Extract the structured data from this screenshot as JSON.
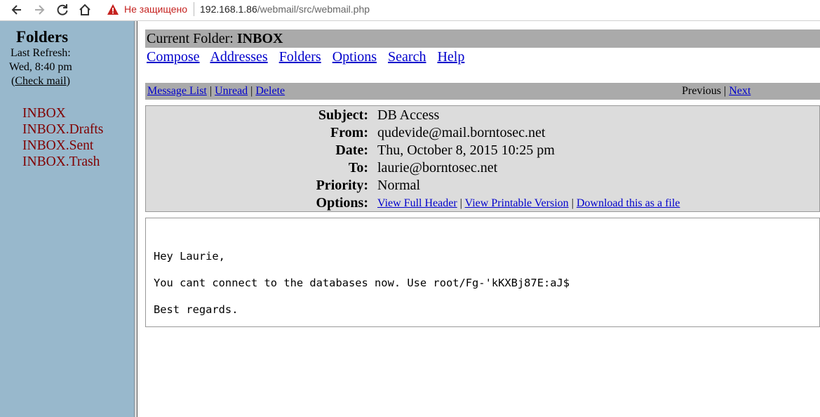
{
  "browser": {
    "security_label": "Не защищено",
    "url_host": "192.168.1.86",
    "url_path": "/webmail/src/webmail.php"
  },
  "sidebar": {
    "title": "Folders",
    "refresh_label": "Last Refresh:",
    "refresh_time": "Wed, 8:40 pm",
    "check_mail_open": "(",
    "check_mail_label": "Check mail",
    "check_mail_close": ")",
    "folders": [
      "INBOX",
      "INBOX.Drafts",
      "INBOX.Sent",
      "INBOX.Trash"
    ]
  },
  "header": {
    "current_folder_label": "Current Folder:",
    "current_folder_name": "INBOX"
  },
  "menu": {
    "compose": "Compose",
    "addresses": "Addresses",
    "folders": "Folders",
    "options": "Options",
    "search": "Search",
    "help": "Help"
  },
  "message_bar": {
    "message_list": "Message List",
    "unread": "Unread",
    "delete": "Delete",
    "separator": "|",
    "previous": "Previous",
    "next": "Next"
  },
  "message": {
    "subject_label": "Subject:",
    "subject": "DB Access",
    "from_label": "From:",
    "from": "qudevide@mail.borntosec.net",
    "date_label": "Date:",
    "date": "Thu, October 8, 2015 10:25 pm",
    "to_label": "To:",
    "to": "laurie@borntosec.net",
    "priority_label": "Priority:",
    "priority": "Normal",
    "options_label": "Options:",
    "view_full_header": "View Full Header",
    "view_printable": "View Printable Version",
    "download": "Download this as a file",
    "body": "Hey Laurie,\n\nYou cant connect to the databases now. Use root/Fg-'kKXBj87E:aJ$\n\nBest regards."
  },
  "colors": {
    "sidebar_bg": "#98b8cc",
    "folder_link": "#800000",
    "link": "#0000cc",
    "bar_bg": "#aaaaaa",
    "header_bg": "#dcdcdc",
    "insecure_red": "#c5221f"
  },
  "icons": [
    "back-arrow-icon",
    "forward-arrow-icon",
    "reload-icon",
    "home-icon",
    "warning-icon"
  ]
}
